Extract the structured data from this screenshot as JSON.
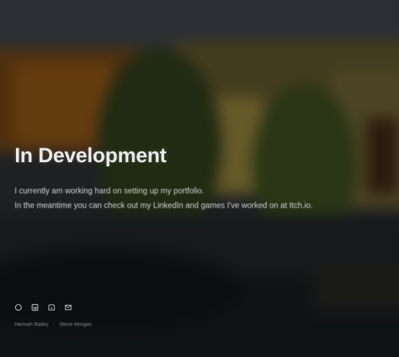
{
  "hero": {
    "title": "In Development",
    "lines": [
      "I currently am working hard on setting up my portfolio.",
      "In the meantime you can check out my LinkedIn and games I've worked on at Itch.io."
    ]
  },
  "social_icons": [
    "github-icon",
    "linkedin-icon",
    "itchio-icon",
    "email-icon"
  ],
  "footer": {
    "credits": [
      "Hannah Bailey",
      "Steve Morgan"
    ]
  },
  "colors": {
    "sky": "#3a4045",
    "foliage_orange": "#7a4a18",
    "building": "#6f6030",
    "tree": "#2f3f1c",
    "road": "#1a1d22"
  }
}
